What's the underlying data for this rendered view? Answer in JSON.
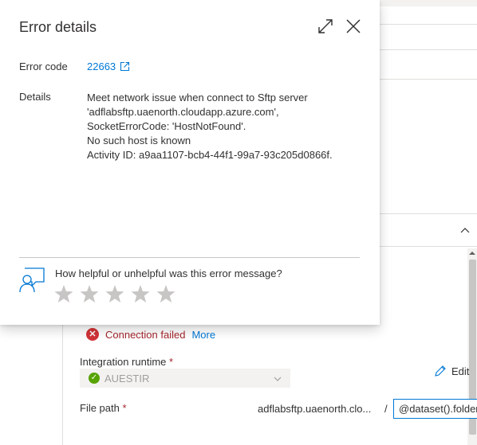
{
  "dialog": {
    "title": "Error details",
    "error_code_label": "Error code",
    "error_code_value": "22663",
    "details_label": "Details",
    "details_lines": [
      "Meet network issue when connect to Sftp server",
      "'adflabsftp.uaenorth.cloudapp.azure.com',",
      "SocketErrorCode: 'HostNotFound'.",
      "No such host is known",
      "Activity ID: a9aa1107-bcb4-44f1-99a7-93c205d0866f."
    ],
    "feedback_question": "How helpful or unhelpful was this error message?",
    "star_count": 5,
    "rating": 0,
    "icons": [
      "expand-icon",
      "close-icon",
      "external-link-icon",
      "feedback-person-icon",
      "star-icon"
    ]
  },
  "background": {
    "connection_status": "Connection failed",
    "more_link": "More",
    "integration_runtime_label": "Integration runtime",
    "required_marker": "*",
    "integration_runtime_value": "AUESTIR",
    "edit_label": "Edit",
    "file_path_label": "File path",
    "file_path_host": "adflabsftp.uaenorth.clo...",
    "file_path_separator": "/",
    "file_path_value": "@dataset().folderPath"
  },
  "colors": {
    "accent": "#0078d4",
    "error": "#d13438",
    "success": "#57a300",
    "text": "#323130"
  }
}
